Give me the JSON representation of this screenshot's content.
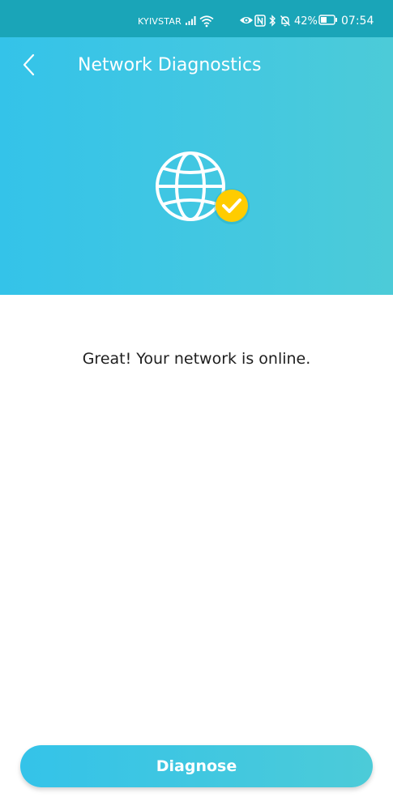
{
  "status_bar": {
    "carrier": "KYIVSTAR",
    "battery_percent": "42%",
    "time": "07:54",
    "icons": [
      "signal-icon",
      "wifi-icon",
      "eye-icon",
      "nfc-icon",
      "bluetooth-icon",
      "bell-off-icon",
      "battery-icon"
    ]
  },
  "header": {
    "title": "Network Diagnostics",
    "back_icon": "back-chevron-icon"
  },
  "hero": {
    "icon": "globe-check-icon",
    "gradient": [
      "#34c3e9",
      "#4ccbd8"
    ],
    "badge_color": "#ffcc00"
  },
  "main": {
    "message": "Great! Your network is online."
  },
  "footer": {
    "diagnose_label": "Diagnose"
  }
}
